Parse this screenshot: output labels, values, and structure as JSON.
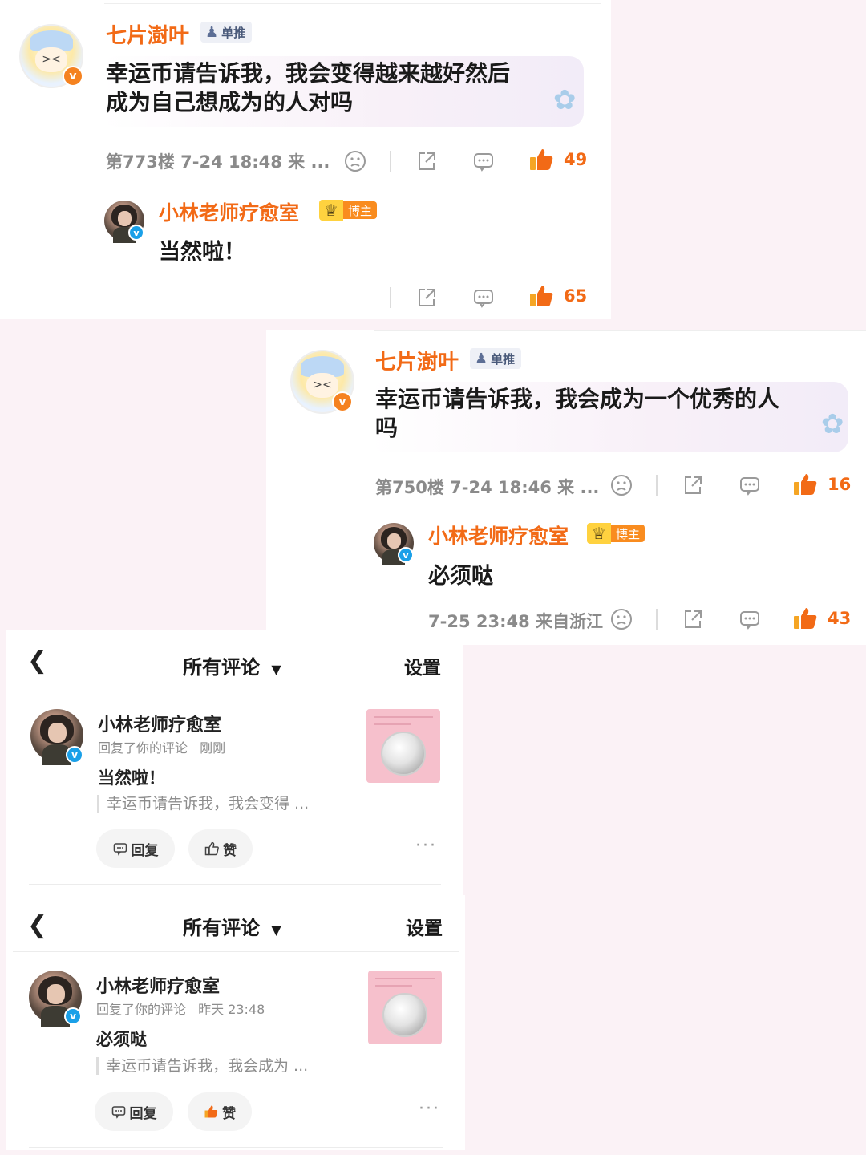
{
  "comment1": {
    "author": "七片澍叶",
    "author_badge": "单推",
    "text_line1": "幸运币请告诉我，我会变得越来越好然后",
    "text_line2": "成为自己想成为的人对吗",
    "meta": "第773楼 7-24 18:48 来 ...",
    "likes": "49",
    "reply": {
      "author": "小林老师疗愈室",
      "host_badge": "博主",
      "text": "当然啦！",
      "likes": "65"
    }
  },
  "comment2": {
    "author": "七片澍叶",
    "author_badge": "单推",
    "text_line1": "幸运币请告诉我，我会成为一个优秀的人",
    "text_line2": "吗",
    "meta": "第750楼 7-24 18:46 来 ...",
    "likes": "16",
    "reply": {
      "author": "小林老师疗愈室",
      "host_badge": "博主",
      "text": "必须哒",
      "meta": "7-25 23:48 来自浙江",
      "likes": "43"
    }
  },
  "notif1": {
    "header_title": "所有评论",
    "header_settings": "设置",
    "name": "小林老师疗愈室",
    "sub": "回复了你的评论",
    "time": "刚刚",
    "body": "当然啦！",
    "quote": "幸运币请告诉我，我会变得 ...",
    "reply_label": "回复",
    "like_label": "赞",
    "more": "···"
  },
  "notif2": {
    "header_title": "所有评论",
    "header_settings": "设置",
    "name": "小林老师疗愈室",
    "sub": "回复了你的评论",
    "time": "昨天 23:48",
    "body": "必须哒",
    "quote": "幸运币请告诉我，我会成为 ...",
    "reply_label": "回复",
    "like_label": "赞",
    "more": "···"
  },
  "colors": {
    "accent_orange": "#f26a16",
    "verified_blue": "#1aa0e8",
    "background_pink": "#fbf2f6"
  }
}
